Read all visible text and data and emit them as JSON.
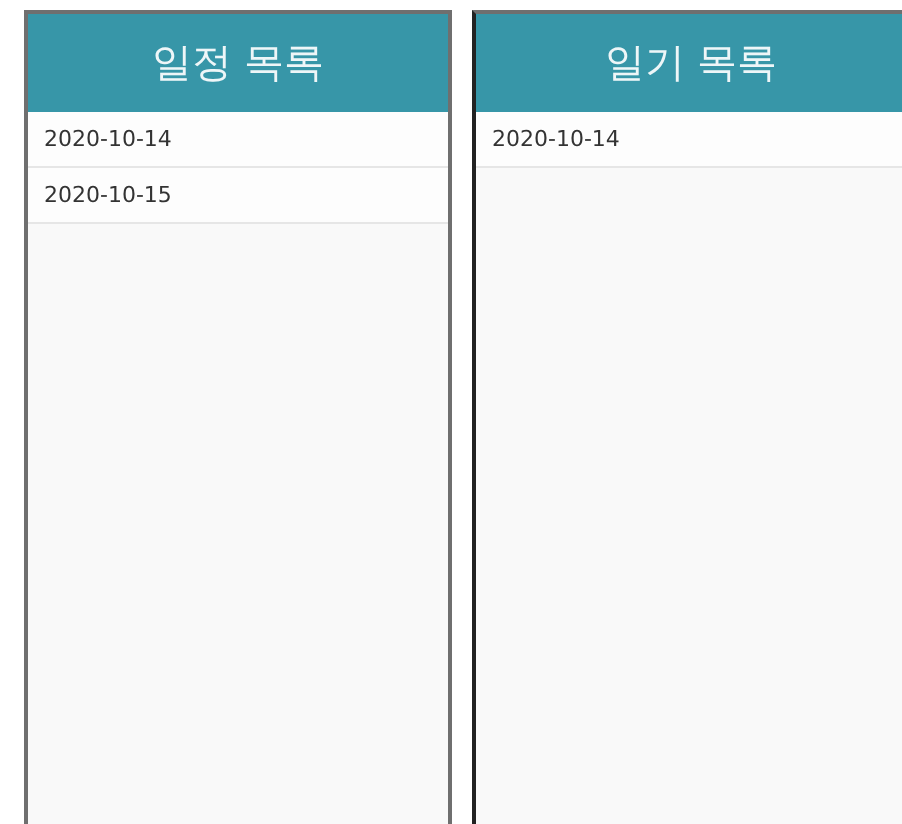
{
  "panels": [
    {
      "title": "일정 목록",
      "items": [
        "2020-10-14",
        "2020-10-15"
      ]
    },
    {
      "title": "일기 목록",
      "items": [
        "2020-10-14"
      ]
    }
  ]
}
